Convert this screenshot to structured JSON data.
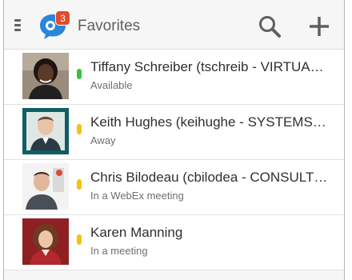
{
  "header": {
    "title": "Favorites",
    "badge_count": "3",
    "icons": [
      "menu-icon",
      "chat-logo-icon",
      "search-icon",
      "add-icon"
    ]
  },
  "colors": {
    "available": "#3cbf3c",
    "away": "#f4c20d",
    "badge": "#e24a2b",
    "logo": "#2a86d8"
  },
  "contacts": [
    {
      "name": "Tiffany Schreiber (tschreib - VIRTUA…",
      "presence": "Available",
      "status": "available"
    },
    {
      "name": "Keith Hughes (keihughe - SYSTEMS…",
      "presence": "Away",
      "status": "away"
    },
    {
      "name": "Chris Bilodeau (cbilodea - CONSULT…",
      "presence": "In a WebEx meeting",
      "status": "away"
    },
    {
      "name": "Karen Manning",
      "presence": "In a meeting",
      "status": "away"
    }
  ]
}
